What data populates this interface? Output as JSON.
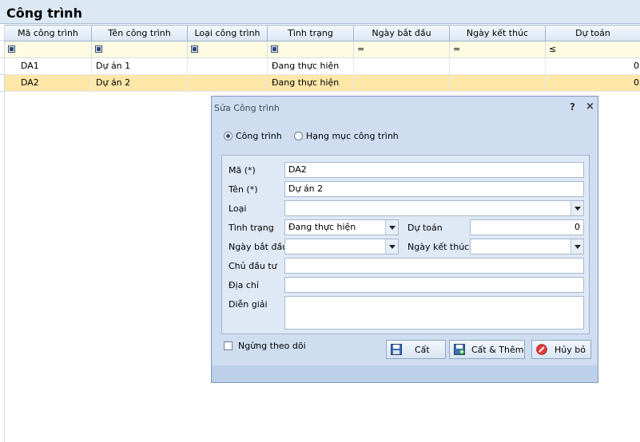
{
  "window": {
    "title": "Công trình"
  },
  "grid": {
    "columns": [
      "Mã công trình",
      "Tên công trình",
      "Loại công trình",
      "Tình trạng",
      "Ngày bắt đầu",
      "Ngày kết thúc",
      "Dự toán"
    ],
    "filter_ops": [
      "",
      "",
      "",
      "",
      "=",
      "=",
      "≤"
    ],
    "rows": [
      {
        "ma": "DA1",
        "ten": "Dự án 1",
        "loai": "",
        "tinh_trang": "Đang thực hiện",
        "bat_dau": "",
        "ket_thuc": "",
        "du_toan": "0"
      },
      {
        "ma": "DA2",
        "ten": "Dự án 2",
        "loai": "",
        "tinh_trang": "Đang thực hiện",
        "bat_dau": "",
        "ket_thuc": "",
        "du_toan": "0"
      }
    ]
  },
  "dialog": {
    "title": "Sửa Công trình",
    "help_glyph": "?",
    "close_glyph": "×",
    "radio_cong_trinh": "Công trình",
    "radio_hang_muc": "Hạng mục công trình",
    "labels": {
      "ma": "Mã (*)",
      "ten": "Tên (*)",
      "loai": "Loại",
      "tinh_trang": "Tình trạng",
      "du_toan": "Dự toán",
      "ngay_bat_dau": "Ngày bắt đầu",
      "ngay_ket_thuc": "Ngày kết thúc",
      "chu_dau_tu": "Chủ đầu tư",
      "dia_chi": "Địa chỉ",
      "dien_giai": "Diễn giải"
    },
    "values": {
      "ma": "DA2",
      "ten": "Dự án 2",
      "loai": "",
      "tinh_trang": "Đang thực hiện",
      "du_toan": "0",
      "ngay_bat_dau": "",
      "ngay_ket_thuc": "",
      "chu_dau_tu": "",
      "dia_chi": "",
      "dien_giai": ""
    },
    "ngung_theo_doi": "Ngừng theo dõi",
    "buttons": {
      "cat": "Cất",
      "cat_them": "Cất & Thêm",
      "huy_bo": "Hủy bỏ"
    }
  },
  "colors": {
    "selected_row": "#fde7a9",
    "filter_row": "#fffbe3",
    "dialog_bg": "#cfddf0"
  }
}
